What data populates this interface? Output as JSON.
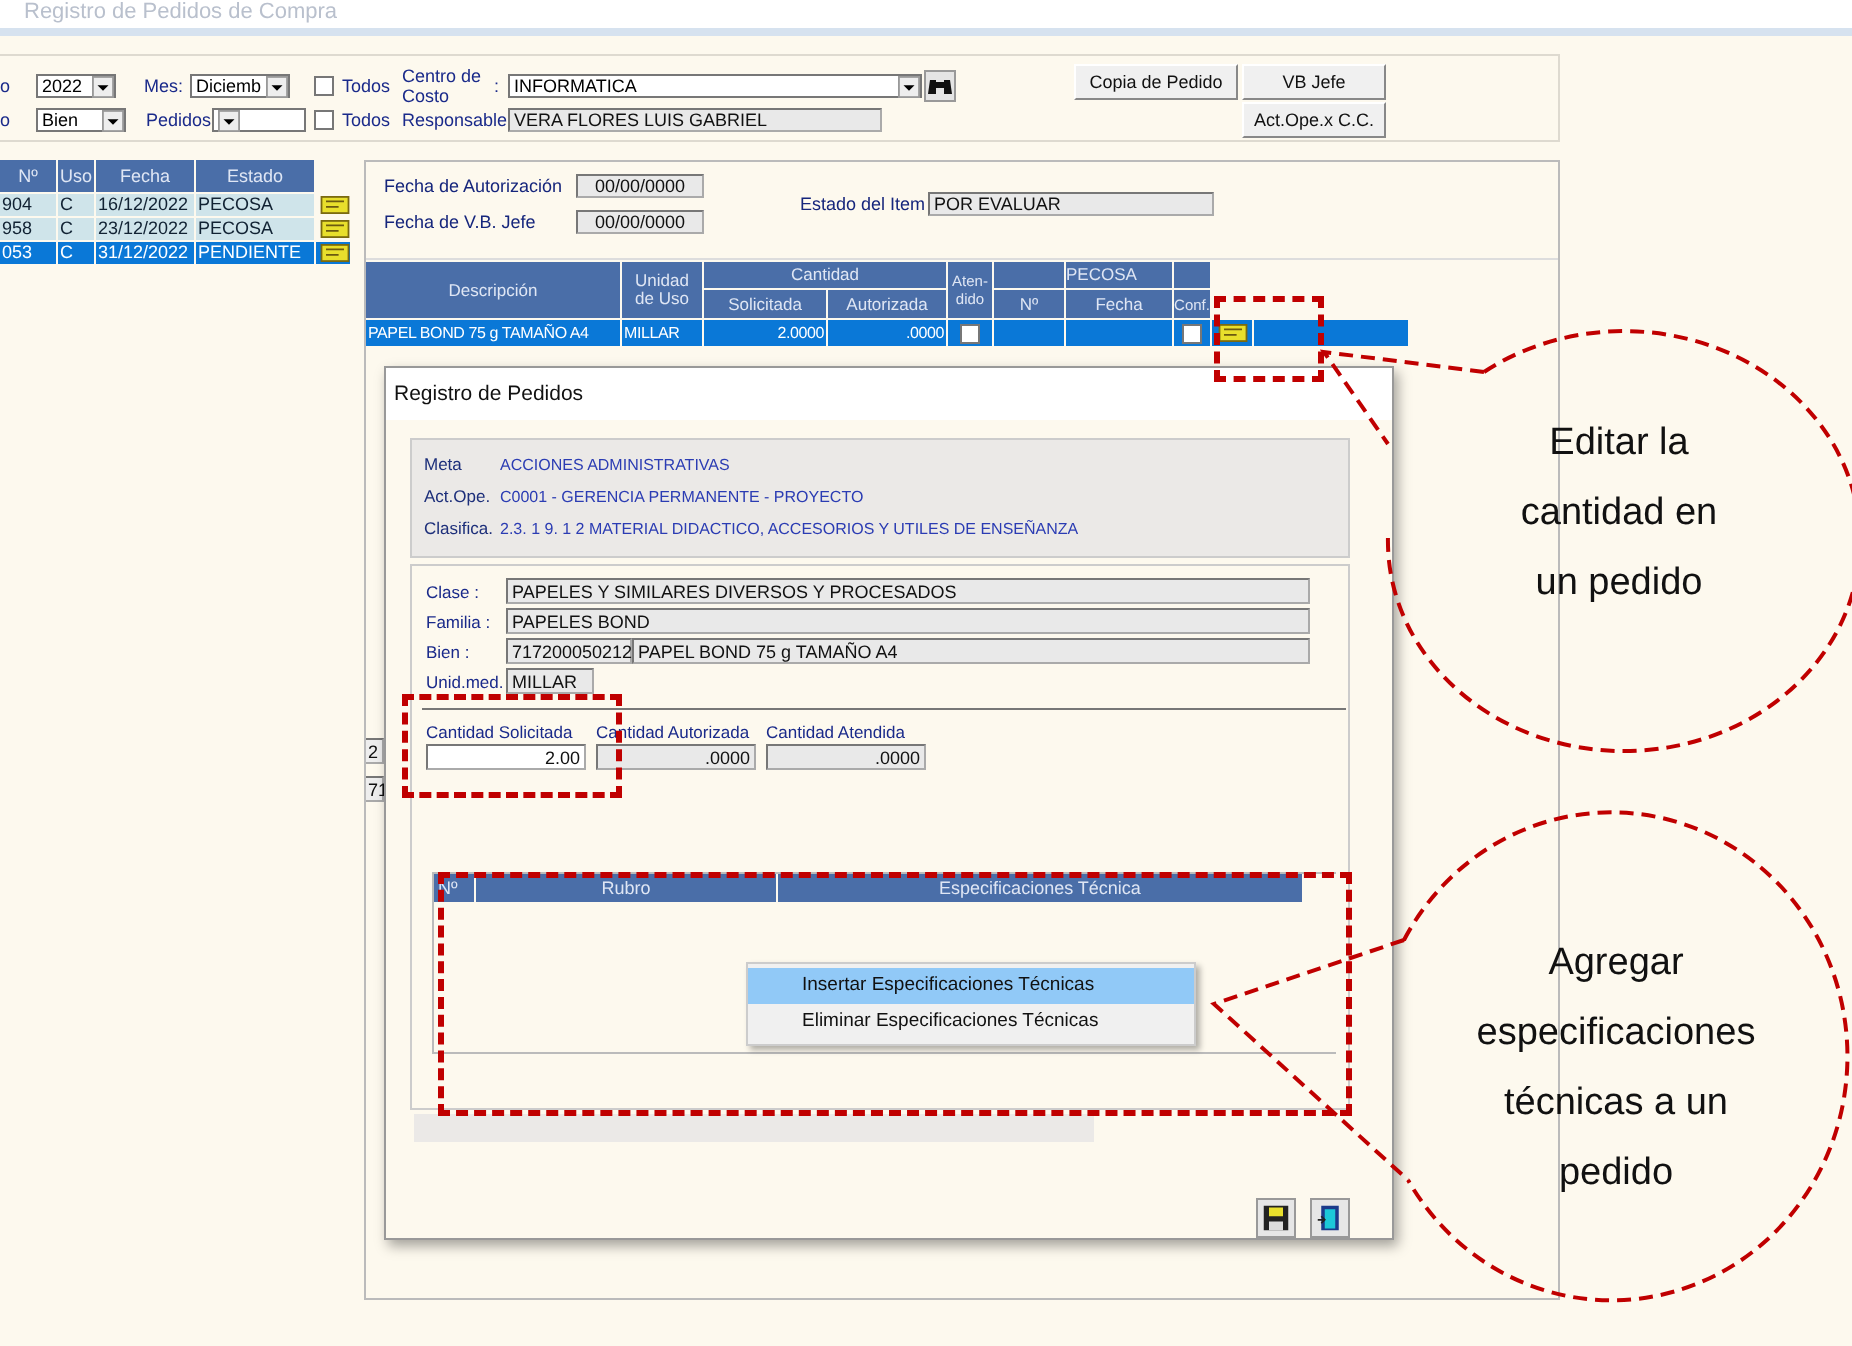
{
  "window": {
    "title": "Registro de Pedidos de Compra"
  },
  "filters": {
    "year_label": "o",
    "year": "2022",
    "month_label": "Mes:",
    "month": "Diciemb",
    "todos_1": {
      "label": "Todos",
      "checked": false
    },
    "centro_label": "Centro de Costo",
    "centro_colon": ":",
    "centro": "INFORMATICA",
    "type_label": "o",
    "type": "Bien",
    "pedidos_label": "Pedidos",
    "todos_2": {
      "label": "Todos",
      "checked": false
    },
    "responsable_label": "Responsable",
    "responsable": "VERA FLORES LUIS GABRIEL"
  },
  "buttons": [
    "Copia de Pedido",
    "VB Jefe",
    "Act.Ope.x C.C."
  ],
  "orders": {
    "columns": [
      "Nº",
      "Uso",
      "Fecha",
      "Estado"
    ],
    "rows": [
      {
        "number": "904",
        "uso": "C",
        "fecha": "16/12/2022",
        "estado": "PECOSA",
        "selected": false
      },
      {
        "number": "958",
        "uso": "C",
        "fecha": "23/12/2022",
        "estado": "PECOSA",
        "selected": false
      },
      {
        "number": "053",
        "uso": "C",
        "fecha": "31/12/2022",
        "estado": "PENDIENTE",
        "selected": true
      }
    ]
  },
  "left_fragments": [
    "2",
    "71"
  ],
  "item_panel": {
    "fecha_aut_label": "Fecha de Autorización",
    "fecha_aut": "00/00/0000",
    "fecha_vb_label": "Fecha de V.B. Jefe",
    "fecha_vb": "00/00/0000",
    "estado_label": "Estado del Item",
    "estado": "POR EVALUAR"
  },
  "items_table": {
    "headers": {
      "descripcion": "Descripción",
      "unidad": "Unidad de Uso",
      "cantidad": "Cantidad",
      "solicitada": "Solicitada",
      "autorizada": "Autorizada",
      "atendido": "Aten-dido",
      "pecosa": "PECOSA",
      "numero": "Nº",
      "fecha": "Fecha",
      "conf": "Conf."
    },
    "rows": [
      {
        "descripcion": "PAPEL BOND  75 g TAMAÑO A4",
        "unidad": "MILLAR",
        "solicitada": "2.0000",
        "autorizada": ".0000",
        "atendido": false,
        "conf": false,
        "selected": true
      }
    ]
  },
  "dialog": {
    "title": "Registro de Pedidos",
    "meta": [
      {
        "label": "Meta",
        "value": "ACCIONES ADMINISTRATIVAS"
      },
      {
        "label": "Act.Ope.",
        "value": "C0001 - GERENCIA PERMANENTE - PROYECTO"
      },
      {
        "label": "Clasifica.",
        "value": "2.3.  1  9.  1  2   MATERIAL DIDACTICO, ACCESORIOS Y UTILES DE ENSEÑANZA"
      }
    ],
    "clase_label": "Clase :",
    "clase": "PAPELES Y SIMILARES DIVERSOS Y PROCESADOS",
    "familia_label": "Familia :",
    "familia": "PAPELES BOND",
    "bien_label": "Bien :",
    "bien_code": "717200050212",
    "bien": "PAPEL BOND  75 g TAMAÑO A4",
    "unid_label": "Unid.med.",
    "unid": "MILLAR",
    "cantidades": [
      {
        "label": "Cantidad Solicitada",
        "value": "2.00",
        "editable": true
      },
      {
        "label": "Cantidad Autorizada",
        "value": ".0000",
        "editable": false
      },
      {
        "label": "Cantidad Atendida",
        "value": ".0000",
        "editable": false
      }
    ],
    "spec_columns": [
      "Nº",
      "Rubro",
      "Especificaciones Técnica"
    ],
    "context_menu": [
      {
        "label": "Insertar Especificaciones Técnicas",
        "selected": true
      },
      {
        "label": "Eliminar Especificaciones Técnicas",
        "selected": false
      }
    ]
  },
  "annotations": [
    {
      "text": "Editar la cantidad en un pedido"
    },
    {
      "text": "Agregar especificaciones técnicas a un pedido"
    }
  ]
}
